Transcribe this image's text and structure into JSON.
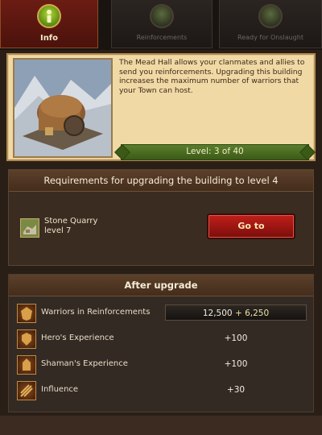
{
  "tabs": [
    {
      "label": "Info",
      "icon": "info-icon",
      "active": true
    },
    {
      "label": "Reinforcements",
      "icon": "reinforcements-icon",
      "active": false
    },
    {
      "label": "Ready for Onslaught",
      "icon": "onslaught-icon",
      "active": false
    }
  ],
  "info": {
    "description": "The Mead Hall allows your clanmates and allies to send you reinforcements. Upgrading this building increases the maximum number of warriors that your Town can host.",
    "level_text": "Level: 3 of 40",
    "level_current": 3,
    "level_max": 40
  },
  "requirements": {
    "header": "Requirements for upgrading the building to level 4",
    "item_name": "Stone Quarry",
    "item_level": "level 7",
    "go_button": "Go to"
  },
  "after_upgrade": {
    "header": "After upgrade",
    "rows": [
      {
        "label": "Warriors in Reinforcements",
        "value": "12,500",
        "bonus": "+ 6,250",
        "icon": "warriors-icon"
      },
      {
        "label": "Hero's Experience",
        "value": "+100",
        "icon": "hero-icon"
      },
      {
        "label": "Shaman's Experience",
        "value": "+100",
        "icon": "shaman-icon"
      },
      {
        "label": "Influence",
        "value": "+30",
        "icon": "influence-icon"
      }
    ]
  },
  "colors": {
    "active_tab": "#6b1c13",
    "info_bg": "#f1d9a6",
    "level_bar": "#4a6d22",
    "go_button": "#b01a16"
  }
}
